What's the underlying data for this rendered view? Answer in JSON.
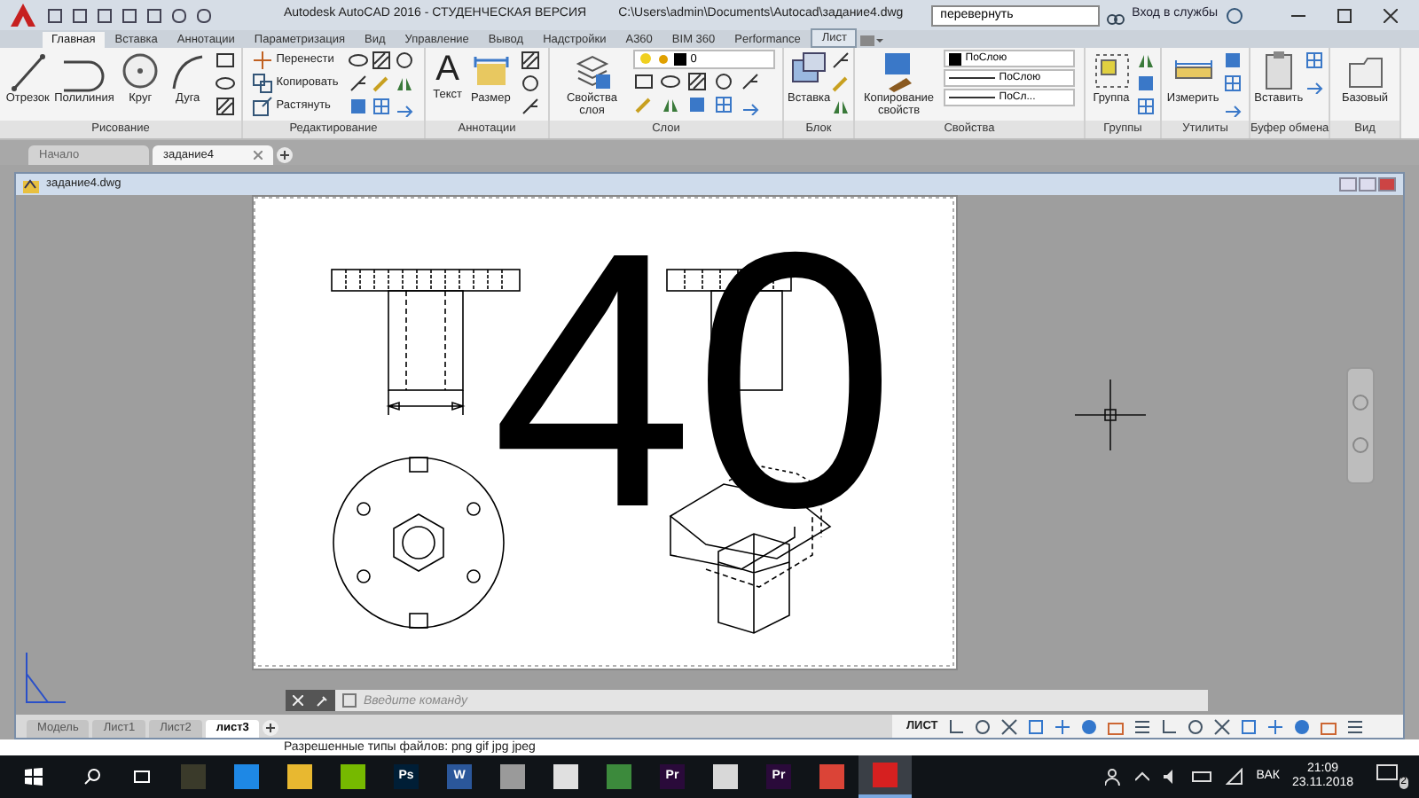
{
  "title_bar": {
    "title": "Autodesk AutoCAD 2016 - СТУДЕНЧЕСКАЯ ВЕРСИЯ",
    "path": "C:\\Users\\admin\\Documents\\Autocad\\задание4.dwg",
    "search": {
      "value": "перевернуть"
    },
    "sign_in": "Вход в службы"
  },
  "ribbon_tabs": [
    {
      "label": "Главная",
      "selected": true,
      "contextual": false
    },
    {
      "label": "Вставка",
      "selected": false,
      "contextual": false
    },
    {
      "label": "Аннотации",
      "selected": false,
      "contextual": false
    },
    {
      "label": "Параметризация",
      "selected": false,
      "contextual": false
    },
    {
      "label": "Вид",
      "selected": false,
      "contextual": false
    },
    {
      "label": "Управление",
      "selected": false,
      "contextual": false
    },
    {
      "label": "Вывод",
      "selected": false,
      "contextual": false
    },
    {
      "label": "Надстройки",
      "selected": false,
      "contextual": false
    },
    {
      "label": "A360",
      "selected": false,
      "contextual": false
    },
    {
      "label": "BIM 360",
      "selected": false,
      "contextual": false
    },
    {
      "label": "Performance",
      "selected": false,
      "contextual": false
    },
    {
      "label": "Лист",
      "selected": false,
      "contextual": true
    }
  ],
  "panels": [
    {
      "title": "Рисование",
      "tools": [
        {
          "kind": "large",
          "label": "Отрезок"
        },
        {
          "kind": "large",
          "label": "Полилиния"
        },
        {
          "kind": "large",
          "label": "Круг"
        },
        {
          "kind": "large",
          "label": "Дуга"
        },
        {
          "kind": "icons"
        }
      ]
    },
    {
      "title": "Редактирование",
      "tools": [
        {
          "kind": "small_list",
          "items": [
            "Перенести",
            "Копировать",
            "Растянуть"
          ]
        },
        {
          "kind": "icons"
        }
      ]
    },
    {
      "title": "Аннотации",
      "tools": [
        {
          "kind": "large",
          "label": "Текст",
          "glyph": "A"
        },
        {
          "kind": "large",
          "label": "Размер"
        },
        {
          "kind": "icons"
        }
      ]
    },
    {
      "title": "Слои",
      "tools": [
        {
          "kind": "large",
          "label": "Свойства слоя"
        },
        {
          "kind": "layer",
          "value": "0"
        }
      ]
    },
    {
      "title": "Блок",
      "tools": [
        {
          "kind": "large",
          "label": "Вставка"
        },
        {
          "kind": "icons"
        }
      ]
    },
    {
      "title": "Свойства",
      "tools": [
        {
          "kind": "large",
          "label": "Копирование свойств"
        },
        {
          "kind": "props",
          "items": [
            "ПоСлою",
            "ПоСлою",
            "ПоСл..."
          ]
        }
      ]
    },
    {
      "title": "Группы",
      "tools": [
        {
          "kind": "large",
          "label": "Группа"
        },
        {
          "kind": "icons"
        }
      ]
    },
    {
      "title": "Утилиты",
      "tools": [
        {
          "kind": "large",
          "label": "Измерить"
        },
        {
          "kind": "icons"
        }
      ]
    },
    {
      "title": "Буфер обмена",
      "tools": [
        {
          "kind": "large",
          "label": "Вставить"
        },
        {
          "kind": "icons"
        }
      ]
    },
    {
      "title": "Вид",
      "tools": [
        {
          "kind": "large",
          "label": "Базовый"
        }
      ]
    }
  ],
  "file_tabs": [
    {
      "label": "Начало",
      "selected": false
    },
    {
      "label": "задание4",
      "selected": true
    }
  ],
  "document": {
    "title": "задание4.dwg",
    "overlay_number": "40"
  },
  "command_line": {
    "placeholder": "Введите команду"
  },
  "layout_tabs": [
    {
      "label": "Модель",
      "selected": false
    },
    {
      "label": "Лист1",
      "selected": false
    },
    {
      "label": "Лист2",
      "selected": false
    },
    {
      "label": "лист3",
      "selected": true
    }
  ],
  "status_bar": {
    "mode": "ЛИСТ"
  },
  "notice": "Разрешенные типы файлов: png gif jpg jpeg",
  "taskbar": {
    "apps": [
      {
        "color": "#3a3a2a",
        "selected": false
      },
      {
        "color": "#1e88e5",
        "selected": false
      },
      {
        "color": "#e8b830",
        "selected": false
      },
      {
        "color": "#76b900",
        "selected": false
      },
      {
        "color": "#001e36",
        "glyph": "Ps",
        "selected": false
      },
      {
        "color": "#2b579a",
        "glyph": "W",
        "selected": false
      },
      {
        "color": "#9a9a9a",
        "selected": false
      },
      {
        "color": "#e0e0e0",
        "selected": false
      },
      {
        "color": "#3c8a3c",
        "selected": false
      },
      {
        "color": "#2a0a3a",
        "glyph": "Pr",
        "selected": false
      },
      {
        "color": "#d8d8d8",
        "selected": false
      },
      {
        "color": "#2a0a3a",
        "glyph": "Pr",
        "selected": false
      },
      {
        "color": "#db4437",
        "selected": false
      },
      {
        "color": "#d62020",
        "selected": true
      }
    ],
    "language": "ВАК",
    "time": "21:09",
    "date": "23.11.2018",
    "notifications": "2"
  }
}
